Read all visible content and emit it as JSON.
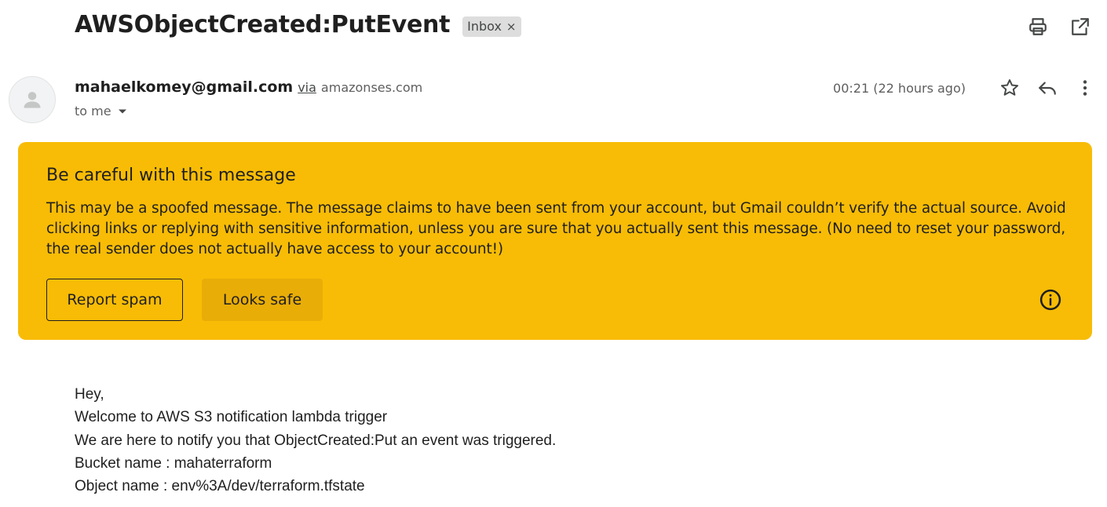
{
  "header": {
    "subject": "AWSObjectCreated:PutEvent",
    "label": "Inbox",
    "label_remove": "×"
  },
  "icons": {
    "print": "print-icon",
    "open_new_window": "open-in-new-window-icon",
    "star": "star-icon",
    "reply": "reply-icon",
    "more": "more-vertical-icon",
    "avatar": "person-icon",
    "dropdown": "chevron-down-icon",
    "info": "info-icon"
  },
  "sender": {
    "email": "mahaelkomey@gmail.com",
    "via_label": "via",
    "via_domain": "amazonses.com",
    "to_label": "to me",
    "timestamp": "00:21 (22 hours ago)"
  },
  "warning": {
    "title": "Be careful with this message",
    "text": "This may be a spoofed message. The message claims to have been sent from your account, but Gmail couldn’t verify the actual source. Avoid clicking links or replying with sensitive information, unless you are sure that you actually sent this message. (No need to reset your password, the real sender does not actually have access to your account!)",
    "report_button": "Report spam",
    "safe_button": "Looks safe",
    "background_color": "#f8bc06"
  },
  "body": {
    "lines": [
      "Hey,",
      "Welcome to AWS S3 notification lambda trigger",
      "We are here to notify you that ObjectCreated:Put an event was triggered.",
      "Bucket name : mahaterraform",
      "Object name : env%3A/dev/terraform.tfstate"
    ]
  }
}
